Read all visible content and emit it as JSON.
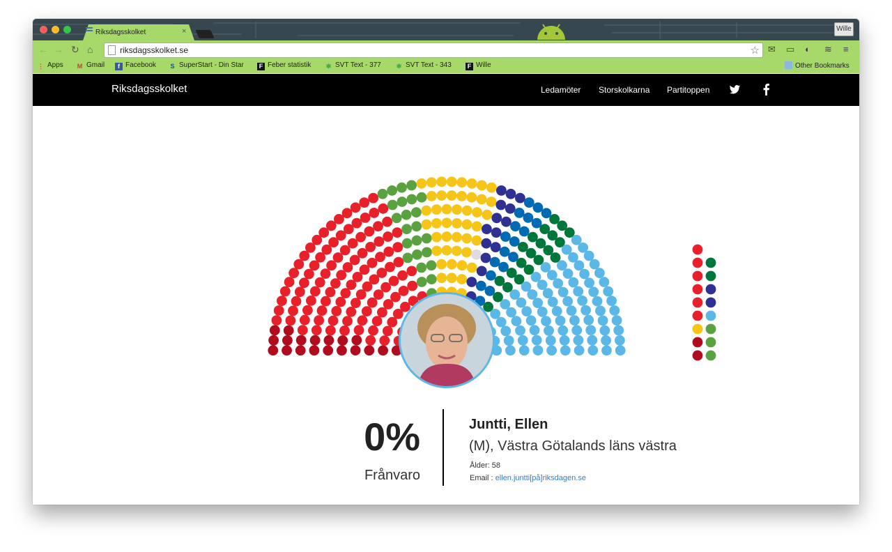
{
  "browser": {
    "tab_title": "Riksdagsskolket",
    "user_button": "Wille",
    "url": "riksdagsskolket.se",
    "bookmarks": [
      {
        "label": "Apps",
        "icon": "apps-grid-icon"
      },
      {
        "label": "Gmail",
        "icon": "gmail-icon"
      },
      {
        "label": "Facebook",
        "icon": "facebook-icon"
      },
      {
        "label": "SuperStart - Din Star",
        "icon": "superstart-icon"
      },
      {
        "label": "Feber statistik",
        "icon": "feber-icon"
      },
      {
        "label": "SVT Text - 377",
        "icon": "svt-icon"
      },
      {
        "label": "SVT Text - 343",
        "icon": "svt-icon"
      },
      {
        "label": "Wille",
        "icon": "feber-icon"
      }
    ],
    "other_bookmarks": "Other Bookmarks"
  },
  "site": {
    "brand": "Riksdagsskolket",
    "nav": [
      "Ledamöter",
      "Storskolkarna",
      "Partitoppen"
    ]
  },
  "parliament": {
    "party_colors": {
      "S": "#e8202a",
      "MP": "#5aa240",
      "V": "#b00c1e",
      "C": "#00763b",
      "L": "#006ab2",
      "KD": "#2e3191",
      "M": "#5bb8e6",
      "SD": "#f5c518",
      "vacant": "#dddddd"
    },
    "seat_sequence": [
      {
        "party": "V",
        "count": 19
      },
      {
        "party": "S",
        "count": 113
      },
      {
        "party": "MP",
        "count": 25
      },
      {
        "party": "SD",
        "count": 49
      },
      {
        "party": "vacant",
        "count": 1
      },
      {
        "party": "KD",
        "count": 16
      },
      {
        "party": "L",
        "count": 19
      },
      {
        "party": "C",
        "count": 22
      },
      {
        "party": "M",
        "count": 84
      }
    ],
    "extra_columns": [
      [
        "S",
        "S",
        "S",
        "S",
        "S",
        "S",
        "SD",
        "V",
        "V"
      ],
      [
        "C",
        "C",
        "KD",
        "KD",
        "M",
        "MP",
        "MP",
        "MP"
      ]
    ]
  },
  "member": {
    "absence_percent": "0%",
    "absence_label": "Frånvaro",
    "name": "Juntti, Ellen",
    "party_district": "(M), Västra Götalands läns västra",
    "age": "Ålder: 58",
    "email_label": "Email :",
    "email": "ellen.juntti[på]riksdagen.se"
  }
}
